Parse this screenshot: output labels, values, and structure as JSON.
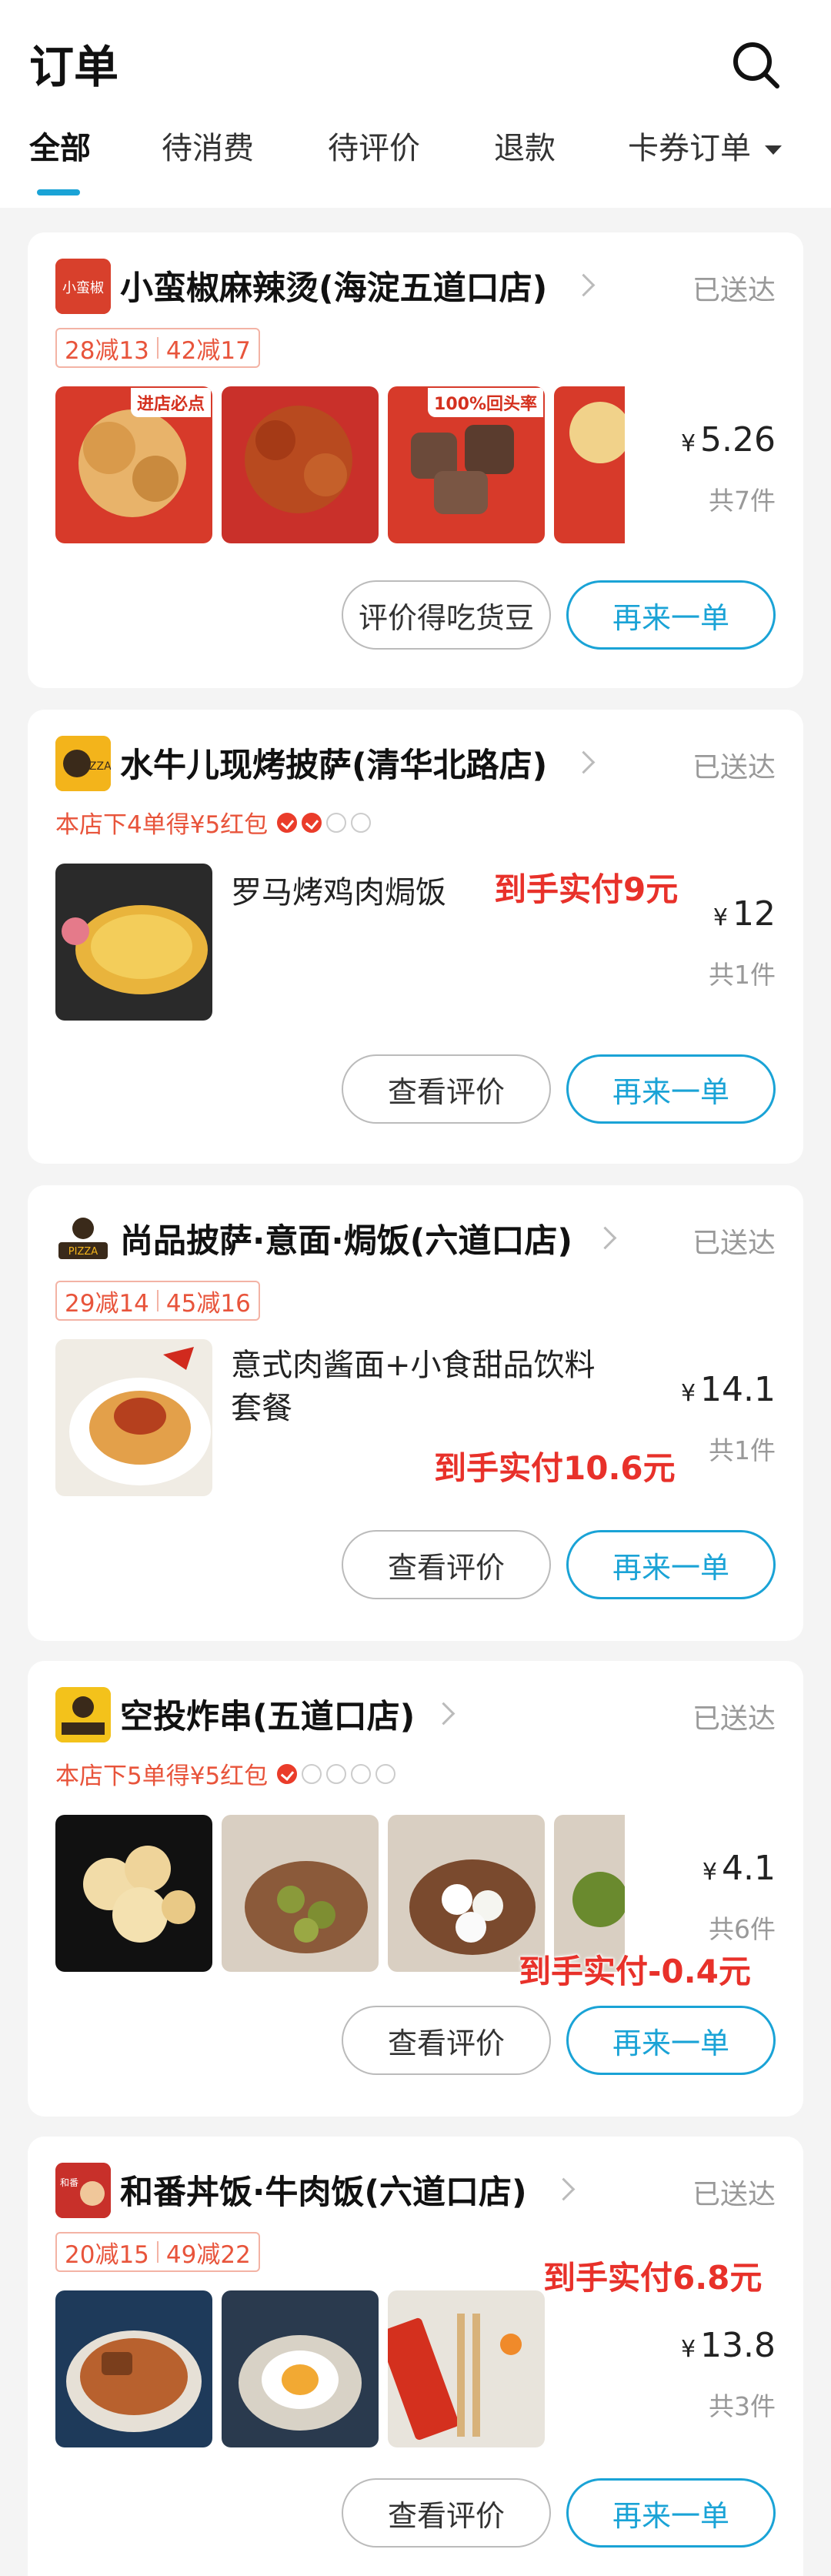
{
  "header": {
    "title": "订单"
  },
  "tabs": [
    {
      "label": "全部"
    },
    {
      "label": "待消费"
    },
    {
      "label": "待评价"
    },
    {
      "label": "退款"
    },
    {
      "label": "卡券订单"
    }
  ],
  "orders": [
    {
      "shop": "小蛮椒麻辣烫(海淀五道口店)",
      "status": "已送达",
      "promo": [
        "28减13",
        "42减17"
      ],
      "thumb_tags": [
        "进店必点",
        "",
        "100%回头率",
        ""
      ],
      "price_symbol": "¥",
      "price": "5.26",
      "count": "共7件",
      "btn_left": "评价得吃货豆",
      "btn_right": "再来一单"
    },
    {
      "shop": "水牛儿现烤披萨(清华北路店)",
      "status": "已送达",
      "promo_text": "本店下4单得¥5红包",
      "stamps_done": 2,
      "stamps_total": 4,
      "item": "罗马烤鸡肉焗饭",
      "overlay": "到手实付9元",
      "price_symbol": "¥",
      "price": "12",
      "count": "共1件",
      "btn_left": "查看评价",
      "btn_right": "再来一单"
    },
    {
      "shop": "尚品披萨·意面·焗饭(六道口店)",
      "status": "已送达",
      "promo": [
        "29减14",
        "45减16"
      ],
      "item": "意式肉酱面+小食甜品饮料套餐",
      "overlay": "到手实付10.6元",
      "price_symbol": "¥",
      "price": "14.1",
      "count": "共1件",
      "btn_left": "查看评价",
      "btn_right": "再来一单"
    },
    {
      "shop": "空投炸串(五道口店)",
      "status": "已送达",
      "promo_text": "本店下5单得¥5红包",
      "stamps_done": 1,
      "stamps_total": 5,
      "overlay": "到手实付-0.4元",
      "price_symbol": "¥",
      "price": "4.1",
      "count": "共6件",
      "btn_left": "查看评价",
      "btn_right": "再来一单"
    },
    {
      "shop": "和番丼饭·牛肉饭(六道口店)",
      "status": "已送达",
      "promo": [
        "20减15",
        "49减22"
      ],
      "overlay": "到手实付6.8元",
      "price_symbol": "¥",
      "price": "13.8",
      "count": "共3件",
      "btn_left": "查看评价",
      "btn_right": "再来一单"
    }
  ],
  "colors": {
    "accent": "#1aa3d6",
    "promo": "#e8543b",
    "overlay": "#e8312a"
  }
}
